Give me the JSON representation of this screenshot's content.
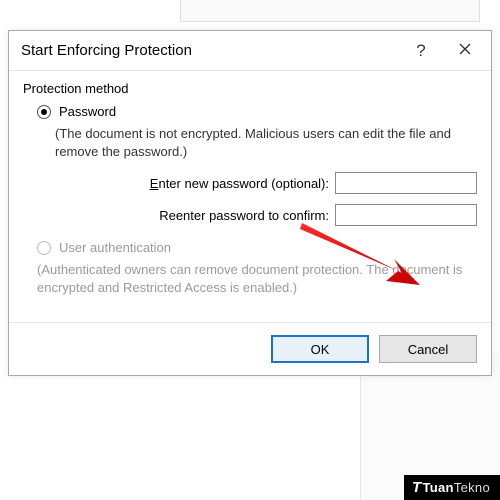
{
  "dialog": {
    "title": "Start Enforcing Protection",
    "help_tooltip": "?",
    "close_tooltip": "Close"
  },
  "section_label": "Protection method",
  "password_option": {
    "label": "Password",
    "hint": "(The document is not encrypted. Malicious users can edit the file and remove the password.)",
    "checked": true
  },
  "fields": {
    "enter_label_pre": "E",
    "enter_label_rest": "nter new password (optional):",
    "enter_value": "",
    "confirm_label": "Reenter password to confirm:",
    "confirm_value": ""
  },
  "userauth_option": {
    "label": "User authentication",
    "hint": "(Authenticated owners can remove document protection. The document is encrypted and Restricted Access is enabled.)",
    "enabled": false
  },
  "buttons": {
    "ok": "OK",
    "cancel": "Cancel"
  },
  "watermark": {
    "brand_strong": "Tuan",
    "brand_light": "Tekno"
  }
}
